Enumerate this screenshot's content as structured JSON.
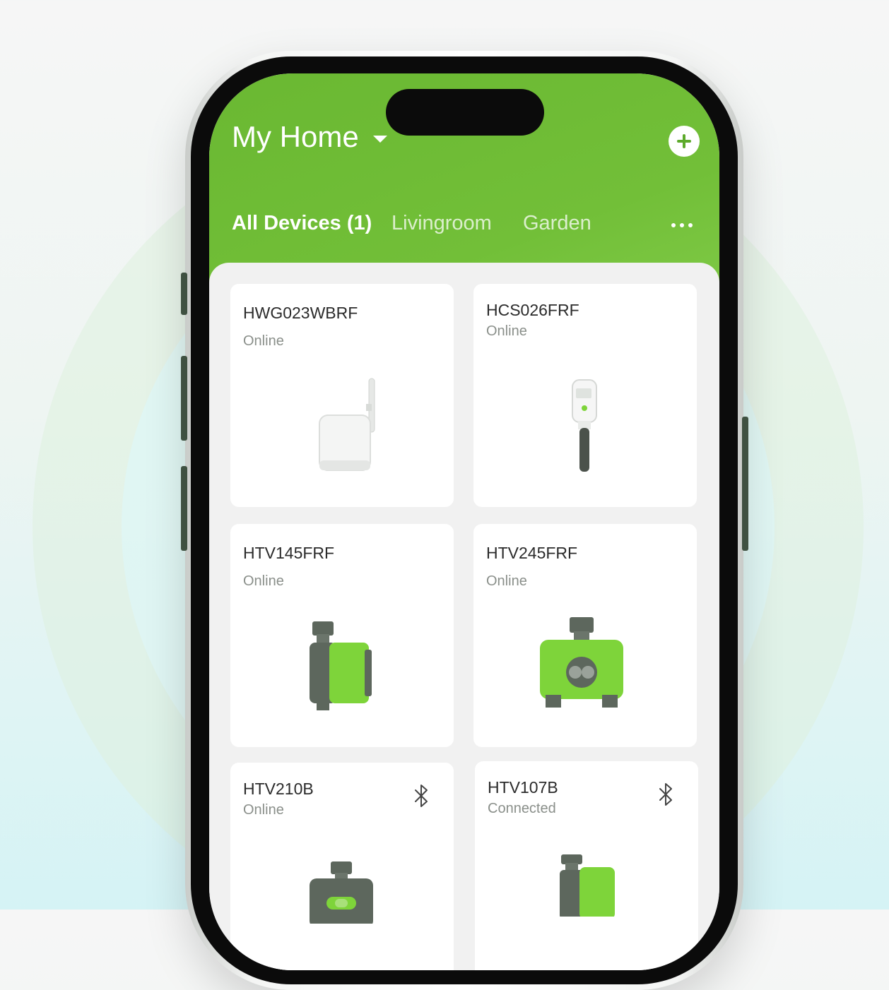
{
  "header": {
    "home_name": "My Home",
    "add_icon": "plus-circle-icon",
    "dropdown_icon": "caret-down-icon"
  },
  "tabs": [
    {
      "label": "All Devices (1)",
      "active": true
    },
    {
      "label": "Livingroom",
      "active": false
    },
    {
      "label": "Garden",
      "active": false
    }
  ],
  "more_icon": "more-horizontal-icon",
  "devices": [
    {
      "name": "HWG023WBRF",
      "status": "Online",
      "image": "gateway-hub-image"
    },
    {
      "name": "HCS026FRF",
      "status": "Online",
      "image": "soil-sensor-image"
    },
    {
      "name": "HTV145FRF",
      "status": "Online",
      "image": "single-outlet-timer-image"
    },
    {
      "name": "HTV245FRF",
      "status": "Online",
      "image": "dual-outlet-timer-image"
    },
    {
      "name": "HTV210B",
      "status": "Online",
      "image": "bluetooth-timer-image",
      "connection_icon": "bluetooth-icon"
    },
    {
      "name": "HTV107B",
      "status": "Connected",
      "image": "bluetooth-timer-image",
      "connection_icon": "bluetooth-icon"
    }
  ],
  "colors": {
    "brand_green": "#72bf38",
    "device_green": "#7ed43a",
    "device_gray": "#5d675d"
  }
}
